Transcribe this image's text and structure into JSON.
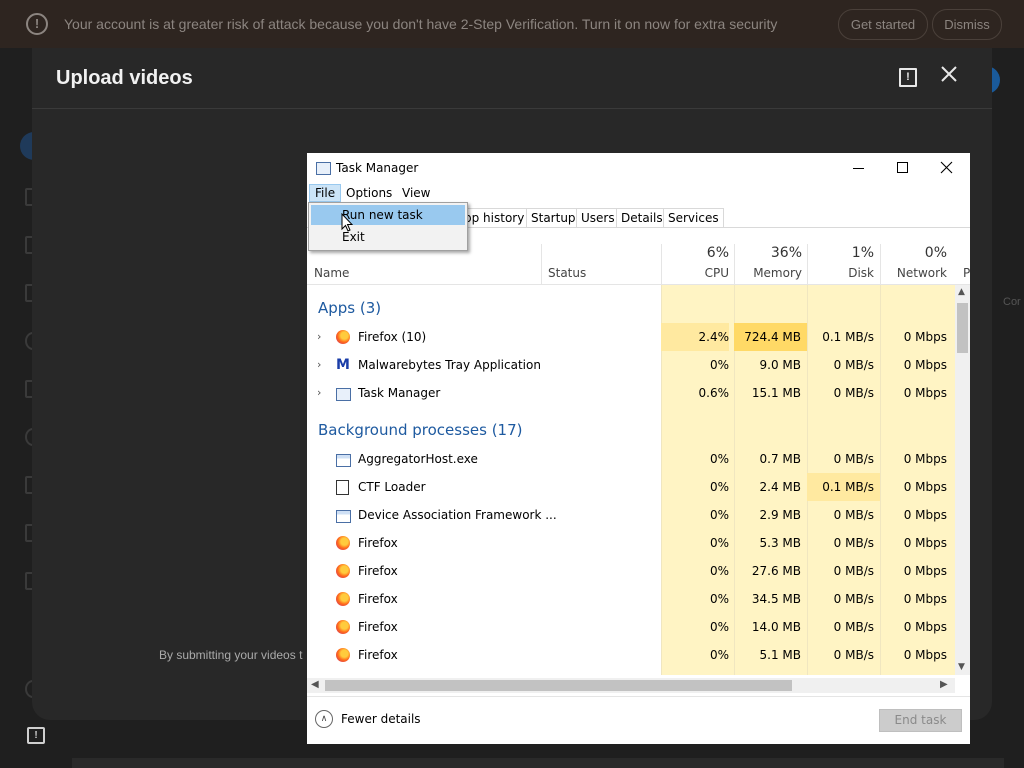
{
  "banner": {
    "message": "Your account is at greater risk of attack because you don't have 2-Step Verification. Turn it on now for extra security",
    "get_started": "Get started",
    "dismiss": "Dismiss"
  },
  "dialog": {
    "title": "Upload videos",
    "fine_print": "By submitting your videos t"
  },
  "background": {
    "right_label": "Cor"
  },
  "task_manager": {
    "title": "Task Manager",
    "menu": [
      "File",
      "Options",
      "View"
    ],
    "file_menu": [
      "Run new task",
      "Exit"
    ],
    "tabs": [
      "pp history",
      "Startup",
      "Users",
      "Details",
      "Services"
    ],
    "columns": {
      "name": "Name",
      "status": "Status",
      "cpu": {
        "pct": "6%",
        "label": "CPU"
      },
      "memory": {
        "pct": "36%",
        "label": "Memory"
      },
      "disk": {
        "pct": "1%",
        "label": "Disk"
      },
      "network": {
        "pct": "0%",
        "label": "Network"
      },
      "extra": "P"
    },
    "groups": {
      "apps": "Apps (3)",
      "background": "Background processes (17)"
    },
    "apps": [
      {
        "name": "Firefox (10)",
        "icon": "firefox-icon",
        "cpu": "2.4%",
        "memory": "724.4 MB",
        "disk": "0.1 MB/s",
        "network": "0 Mbps"
      },
      {
        "name": "Malwarebytes Tray Application",
        "icon": "malwarebytes-icon",
        "cpu": "0%",
        "memory": "9.0 MB",
        "disk": "0 MB/s",
        "network": "0 Mbps"
      },
      {
        "name": "Task Manager",
        "icon": "task-manager-icon",
        "cpu": "0.6%",
        "memory": "15.1 MB",
        "disk": "0 MB/s",
        "network": "0 Mbps"
      }
    ],
    "background": [
      {
        "name": "AggregatorHost.exe",
        "icon": "exe-icon",
        "cpu": "0%",
        "memory": "0.7 MB",
        "disk": "0 MB/s",
        "network": "0 Mbps"
      },
      {
        "name": "CTF Loader",
        "icon": "ctf-icon",
        "cpu": "0%",
        "memory": "2.4 MB",
        "disk": "0.1 MB/s",
        "network": "0 Mbps"
      },
      {
        "name": "Device Association Framework ...",
        "icon": "exe-icon",
        "cpu": "0%",
        "memory": "2.9 MB",
        "disk": "0 MB/s",
        "network": "0 Mbps"
      },
      {
        "name": "Firefox",
        "icon": "firefox-icon",
        "cpu": "0%",
        "memory": "5.3 MB",
        "disk": "0 MB/s",
        "network": "0 Mbps"
      },
      {
        "name": "Firefox",
        "icon": "firefox-icon",
        "cpu": "0%",
        "memory": "27.6 MB",
        "disk": "0 MB/s",
        "network": "0 Mbps"
      },
      {
        "name": "Firefox",
        "icon": "firefox-icon",
        "cpu": "0%",
        "memory": "34.5 MB",
        "disk": "0 MB/s",
        "network": "0 Mbps"
      },
      {
        "name": "Firefox",
        "icon": "firefox-icon",
        "cpu": "0%",
        "memory": "14.0 MB",
        "disk": "0 MB/s",
        "network": "0 Mbps"
      },
      {
        "name": "Firefox",
        "icon": "firefox-icon",
        "cpu": "0%",
        "memory": "5.1 MB",
        "disk": "0 MB/s",
        "network": "0 Mbps"
      }
    ],
    "fewer_details": "Fewer details",
    "end_task": "End task"
  },
  "colors": {
    "banner_bg": "#2e2520",
    "dialog_bg": "#282828",
    "page_bg": "#1f1f1f",
    "heat_light": "#fff4c4",
    "heat_strong": "#ffd966",
    "menu_highlight": "#99c9ef",
    "group_blue": "#1e5aa0"
  }
}
